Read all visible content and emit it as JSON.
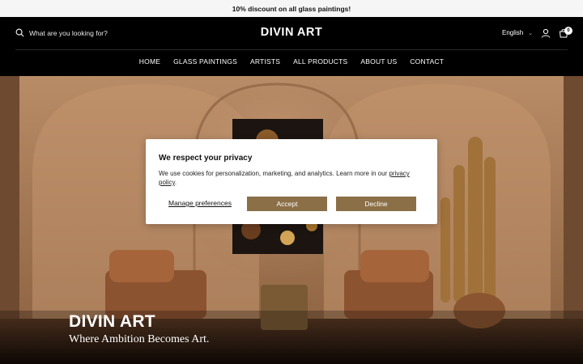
{
  "announcement": {
    "text": "10% discount on all glass paintings!"
  },
  "header": {
    "search_placeholder": "What are you looking for?",
    "logo": "DIVIN ART",
    "language": "English",
    "cart_count": "0"
  },
  "nav": {
    "items": [
      {
        "label": "HOME"
      },
      {
        "label": "GLASS PAINTINGS"
      },
      {
        "label": "ARTISTS"
      },
      {
        "label": "ALL PRODUCTS"
      },
      {
        "label": "ABOUT US"
      },
      {
        "label": "CONTACT"
      }
    ]
  },
  "hero": {
    "title": "DIVIN ART",
    "subtitle": "Where Ambition Becomes Art."
  },
  "cookie": {
    "heading": "We respect your privacy",
    "body": "We use cookies for personalization, marketing, and analytics. Learn more in our",
    "policy_link": "privacy policy",
    "period": ".",
    "manage_label": "Manage preferences",
    "accept_label": "Accept",
    "decline_label": "Decline"
  },
  "colors": {
    "accent": "#8b6f47",
    "header_bg": "#000000",
    "announce_bg": "#f6f6f6"
  }
}
